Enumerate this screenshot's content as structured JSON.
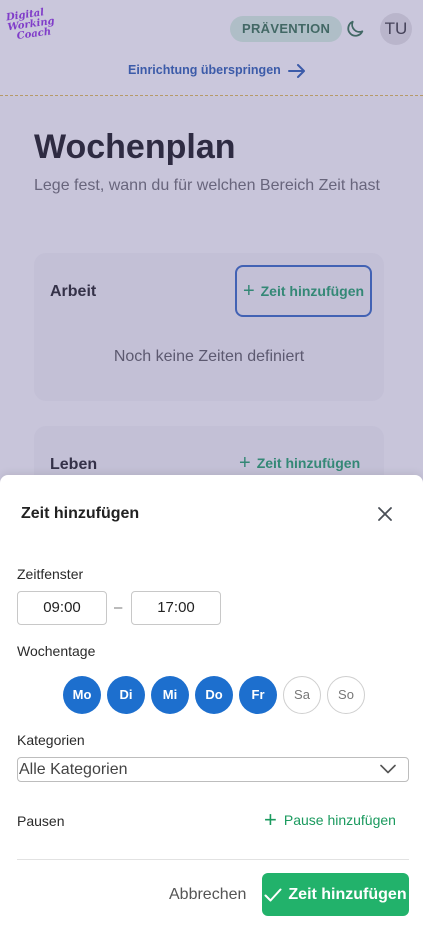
{
  "header": {
    "logo_lines": [
      "Digital",
      "Working",
      "Coach"
    ],
    "badge": "PRÄVENTION",
    "avatar_initials": "TU",
    "skip_link": "Einrichtung überspringen"
  },
  "page": {
    "title": "Wochenplan",
    "subtitle": "Lege fest, wann du für welchen Bereich Zeit hast"
  },
  "categories": [
    {
      "title": "Arbeit",
      "add_label": "Zeit hinzufügen",
      "empty_text": "Noch keine Zeiten definiert"
    },
    {
      "title": "Leben",
      "add_label": "Zeit hinzufügen"
    }
  ],
  "modal": {
    "title": "Zeit hinzufügen",
    "time_window_label": "Zeitfenster",
    "start_time": "09:00",
    "separator": "–",
    "end_time": "17:00",
    "weekdays_label": "Wochentage",
    "days": [
      {
        "label": "Mo",
        "selected": true
      },
      {
        "label": "Di",
        "selected": true
      },
      {
        "label": "Mi",
        "selected": true
      },
      {
        "label": "Do",
        "selected": true
      },
      {
        "label": "Fr",
        "selected": true
      },
      {
        "label": "Sa",
        "selected": false
      },
      {
        "label": "So",
        "selected": false
      }
    ],
    "categories_label": "Kategorien",
    "categories_value": "Alle Kategorien",
    "pauses_label": "Pausen",
    "add_pause": "Pause hinzufügen",
    "cancel": "Abbrechen",
    "submit": "Zeit hinzufügen"
  },
  "colors": {
    "accent_green": "#22b26b",
    "day_selected": "#1d6fce",
    "link_blue": "#2558a8"
  },
  "icons": [
    "moon-icon",
    "arrow-right-icon",
    "plus-icon",
    "close-icon",
    "chevron-down-icon",
    "check-icon"
  ]
}
